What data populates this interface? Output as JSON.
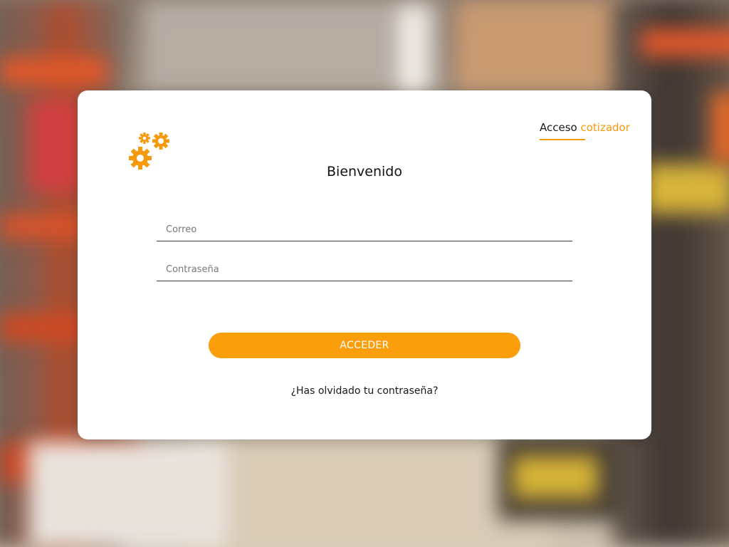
{
  "header": {
    "tab_prefix": "Acceso",
    "tab_accent": "cotizador"
  },
  "login": {
    "title": "Bienvenido",
    "email_placeholder": "Correo",
    "password_placeholder": "Contraseña",
    "submit_label": "ACCEDER",
    "forgot_label": "¿Has olvidado tu contraseña?"
  },
  "logo": {
    "icon": "gears-icon"
  },
  "colors": {
    "accent": "#fa9e0c",
    "card": "#ffffff"
  }
}
